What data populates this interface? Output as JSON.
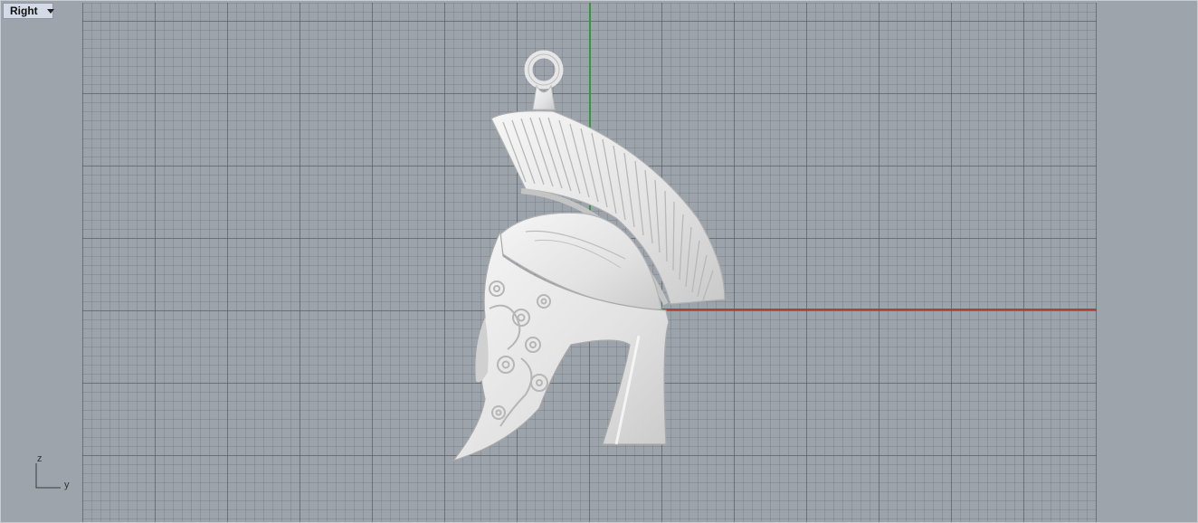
{
  "viewport": {
    "name": "Right",
    "menu_icon": "chevron-down-icon"
  },
  "axis_indicator": {
    "vertical": "z",
    "horizontal": "y"
  },
  "colors": {
    "background": "#9ea4ac",
    "grid_major": "#50555c",
    "grid_minor": "#6e747c",
    "axis_green": "#2e9a3c",
    "axis_red": "#a8423e",
    "model": "#e8e8e8"
  }
}
